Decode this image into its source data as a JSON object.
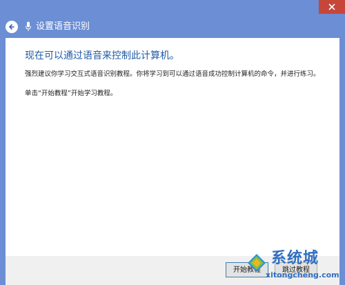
{
  "window": {
    "title": "设置语音识别"
  },
  "content": {
    "heading": "现在可以通过语音来控制此计算机。",
    "paragraph1": "强烈建议你学习交互式语音识别教程。你将学习到可以通过语音成功控制计算机的命令，并进行练习。",
    "paragraph2": "单击“开始教程”开始学习教程。"
  },
  "footer": {
    "start_button": "开始教程",
    "skip_button": "跳过教程"
  },
  "watermark": {
    "brand": "系统城",
    "url": "xitongcheng.com"
  },
  "colors": {
    "title_bg": "#6b8ed4",
    "close_bg": "#c7463a",
    "heading": "#1f5aa6"
  },
  "icons": {
    "close": "close-icon",
    "back": "back-arrow-icon",
    "mic": "microphone-icon"
  }
}
